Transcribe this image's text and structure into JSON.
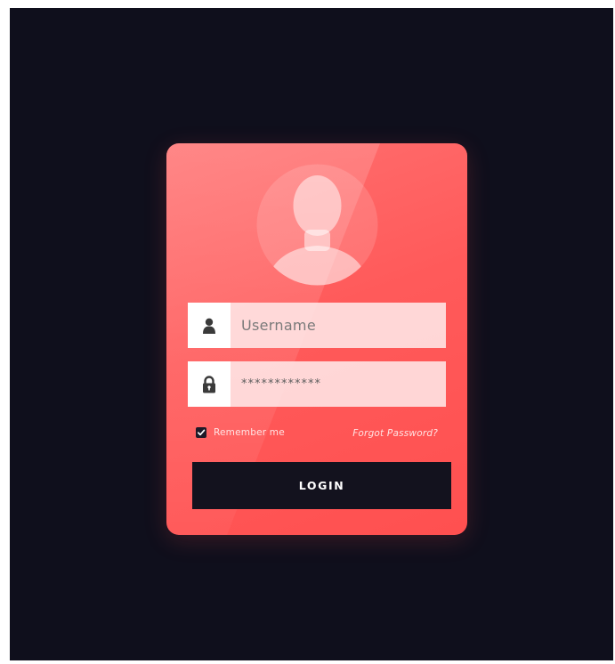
{
  "colors": {
    "background": "#0f0f1c",
    "card": "#ff5a5a",
    "button": "#13121e",
    "field": "#ffe8e8"
  },
  "form": {
    "avatar_icon": "user-silhouette-icon",
    "username": {
      "placeholder": "Username",
      "value": "",
      "icon": "user-icon"
    },
    "password": {
      "value": "************",
      "icon": "lock-icon"
    },
    "remember": {
      "label": "Remember me",
      "checked": true
    },
    "forgot_label": "Forgot Password?",
    "login_label": "LOGIN"
  }
}
